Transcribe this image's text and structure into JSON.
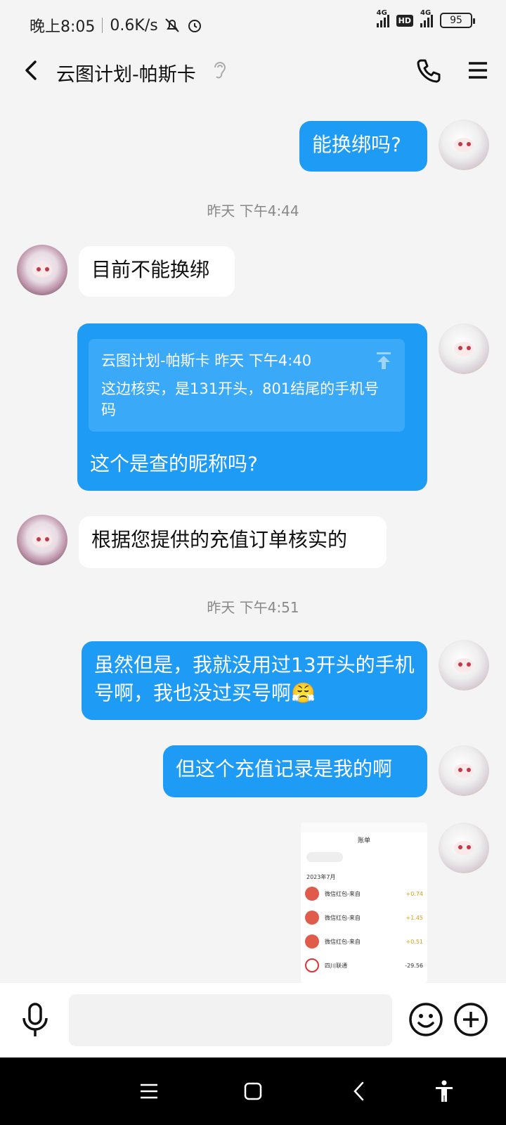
{
  "status": {
    "time": "晚上8:05",
    "speed": "0.6K/s",
    "net1": "4G",
    "hd": "HD",
    "net2": "4G",
    "battery": "95"
  },
  "header": {
    "title": "云图计划-帕斯卡"
  },
  "messages": {
    "m1": "能换绑吗?",
    "t1": "昨天 下午4:44",
    "m2": "目前不能换绑",
    "quote_head": "云图计划-帕斯卡 昨天 下午4:40",
    "quote_body": "这边核实，是131开头，801结尾的手机号码",
    "m3": "这个是查的昵称吗?",
    "m4": "根据您提供的充值订单核实的",
    "t2": "昨天 下午4:51",
    "m5": "虽然但是，我就没用过13开头的手机号啊，我也没过买号啊😤",
    "m6": "但这个充值记录是我的啊"
  },
  "screenshot": {
    "title": "账单",
    "month": "2023年7月",
    "rows": [
      {
        "name": "微信红包-来自",
        "amount": "+0.74"
      },
      {
        "name": "微信红包-来自",
        "amount": "+1.45"
      },
      {
        "name": "微信红包-来自",
        "amount": "+0.51"
      },
      {
        "name": "四川联通",
        "amount": "-29.56"
      }
    ]
  },
  "input": {
    "placeholder": ""
  },
  "colors": {
    "outgoing": "#1e9bf5",
    "incoming": "#ffffff",
    "background": "#f4f4f4"
  }
}
